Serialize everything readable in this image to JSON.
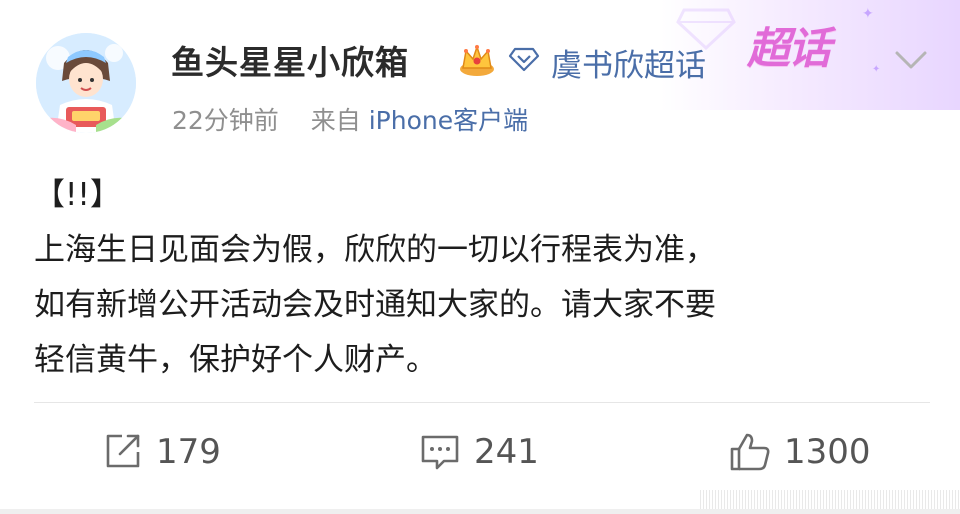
{
  "post": {
    "author": "鱼头星星小欣箱",
    "topic": "虞书欣超话",
    "supertopic_badge": "超话",
    "time": "22分钟前",
    "source_prefix": "来自",
    "source_app": "iPhone客户端",
    "body": [
      "【!!】",
      "上海生日见面会为假，欣欣的一切以行程表为准，",
      "如有新增公开活动会及时通知大家的。请大家不要",
      "轻信黄牛，保护好个人财产。"
    ]
  },
  "actions": {
    "repost_count": "179",
    "comment_count": "241",
    "like_count": "1300"
  },
  "icons": [
    "crown-icon",
    "diamond-icon",
    "chevron-down-icon",
    "repost-icon",
    "comment-icon",
    "like-icon"
  ],
  "colors": {
    "link": "#4a6ea8",
    "badge": "#e16bd8",
    "meta": "#8f8f8f"
  }
}
